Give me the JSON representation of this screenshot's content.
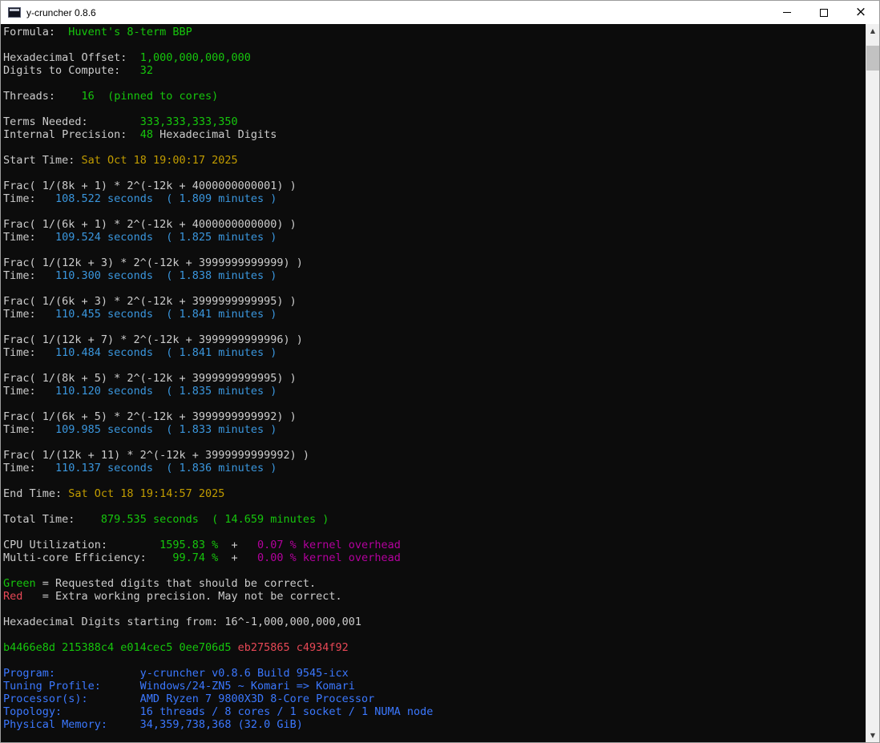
{
  "window": {
    "title": "y-cruncher 0.8.6"
  },
  "icons": {
    "scroll_up": "▲",
    "scroll_down": "▼",
    "close": "×"
  },
  "palette": {
    "white": "#CCCCCC",
    "green": "#16C60C",
    "yellow": "#C19C00",
    "cyan": "#3A96DD",
    "magenta": "#B4009E",
    "red": "#E74856",
    "blue": "#3B78FF",
    "background": "#0C0C0C"
  },
  "console": {
    "lines": [
      [
        [
          "Formula:  ",
          "white"
        ],
        [
          "Huvent's 8-term BBP",
          "green"
        ]
      ],
      [],
      [
        [
          "Hexadecimal Offset:  ",
          "white"
        ],
        [
          "1,000,000,000,000",
          "green"
        ]
      ],
      [
        [
          "Digits to Compute:   ",
          "white"
        ],
        [
          "32",
          "green"
        ]
      ],
      [],
      [
        [
          "Threads:    ",
          "white"
        ],
        [
          "16",
          "green"
        ],
        [
          "  ",
          "white"
        ],
        [
          "(pinned to cores)",
          "green"
        ]
      ],
      [],
      [
        [
          "Terms Needed:        ",
          "white"
        ],
        [
          "333,333,333,350",
          "green"
        ]
      ],
      [
        [
          "Internal Precision:  ",
          "white"
        ],
        [
          "48",
          "green"
        ],
        [
          " Hexadecimal Digits",
          "white"
        ]
      ],
      [],
      [
        [
          "Start Time: ",
          "white"
        ],
        [
          "Sat Oct 18 19:00:17 2025",
          "yellow"
        ]
      ],
      [],
      [
        [
          "Frac( 1/(8k + 1) * 2^(-12k + 4000000000001) )",
          "white"
        ]
      ],
      [
        [
          "Time:   ",
          "white"
        ],
        [
          "108.522 seconds  ( 1.809 minutes )",
          "cyan"
        ]
      ],
      [],
      [
        [
          "Frac( 1/(6k + 1) * 2^(-12k + 4000000000000) )",
          "white"
        ]
      ],
      [
        [
          "Time:   ",
          "white"
        ],
        [
          "109.524 seconds  ( 1.825 minutes )",
          "cyan"
        ]
      ],
      [],
      [
        [
          "Frac( 1/(12k + 3) * 2^(-12k + 3999999999999) )",
          "white"
        ]
      ],
      [
        [
          "Time:   ",
          "white"
        ],
        [
          "110.300 seconds  ( 1.838 minutes )",
          "cyan"
        ]
      ],
      [],
      [
        [
          "Frac( 1/(6k + 3) * 2^(-12k + 3999999999995) )",
          "white"
        ]
      ],
      [
        [
          "Time:   ",
          "white"
        ],
        [
          "110.455 seconds  ( 1.841 minutes )",
          "cyan"
        ]
      ],
      [],
      [
        [
          "Frac( 1/(12k + 7) * 2^(-12k + 3999999999996) )",
          "white"
        ]
      ],
      [
        [
          "Time:   ",
          "white"
        ],
        [
          "110.484 seconds  ( 1.841 minutes )",
          "cyan"
        ]
      ],
      [],
      [
        [
          "Frac( 1/(8k + 5) * 2^(-12k + 3999999999995) )",
          "white"
        ]
      ],
      [
        [
          "Time:   ",
          "white"
        ],
        [
          "110.120 seconds  ( 1.835 minutes )",
          "cyan"
        ]
      ],
      [],
      [
        [
          "Frac( 1/(6k + 5) * 2^(-12k + 3999999999992) )",
          "white"
        ]
      ],
      [
        [
          "Time:   ",
          "white"
        ],
        [
          "109.985 seconds  ( 1.833 minutes )",
          "cyan"
        ]
      ],
      [],
      [
        [
          "Frac( 1/(12k + 11) * 2^(-12k + 3999999999992) )",
          "white"
        ]
      ],
      [
        [
          "Time:   ",
          "white"
        ],
        [
          "110.137 seconds  ( 1.836 minutes )",
          "cyan"
        ]
      ],
      [],
      [
        [
          "End Time: ",
          "white"
        ],
        [
          "Sat Oct 18 19:14:57 2025",
          "yellow"
        ]
      ],
      [],
      [
        [
          "Total Time:    ",
          "white"
        ],
        [
          "879.535 seconds  ( 14.659 minutes )",
          "green"
        ]
      ],
      [],
      [
        [
          "CPU Utilization:        ",
          "white"
        ],
        [
          "1595.83 %",
          "green"
        ],
        [
          "  +   ",
          "white"
        ],
        [
          "0.07 % kernel overhead",
          "magenta"
        ]
      ],
      [
        [
          "Multi-core Efficiency:    ",
          "white"
        ],
        [
          "99.74 %",
          "green"
        ],
        [
          "  +   ",
          "white"
        ],
        [
          "0.00 % kernel overhead",
          "magenta"
        ]
      ],
      [],
      [
        [
          "Green",
          "green"
        ],
        [
          " = Requested digits that should be correct.",
          "white"
        ]
      ],
      [
        [
          "Red",
          "red"
        ],
        [
          "   = Extra working precision. May not be correct.",
          "white"
        ]
      ],
      [],
      [
        [
          "Hexadecimal Digits starting from: 16^-1,000,000,000,001",
          "white"
        ]
      ],
      [],
      [
        [
          "b4466e8d 215388c4 e014cec5 0ee706d5 ",
          "green"
        ],
        [
          "eb275865 c4934f92",
          "red"
        ]
      ],
      [],
      [
        [
          "Program:             y-cruncher v0.8.6 Build 9545-icx",
          "blue"
        ]
      ],
      [
        [
          "Tuning Profile:      Windows/24-ZN5 ~ Komari => Komari",
          "blue"
        ]
      ],
      [
        [
          "Processor(s):        AMD Ryzen 7 9800X3D 8-Core Processor",
          "blue"
        ]
      ],
      [
        [
          "Topology:            16 threads / 8 cores / 1 socket / 1 NUMA node",
          "blue"
        ]
      ],
      [
        [
          "Physical Memory:     34,359,738,368 (32.0 GiB)",
          "blue"
        ]
      ]
    ]
  }
}
